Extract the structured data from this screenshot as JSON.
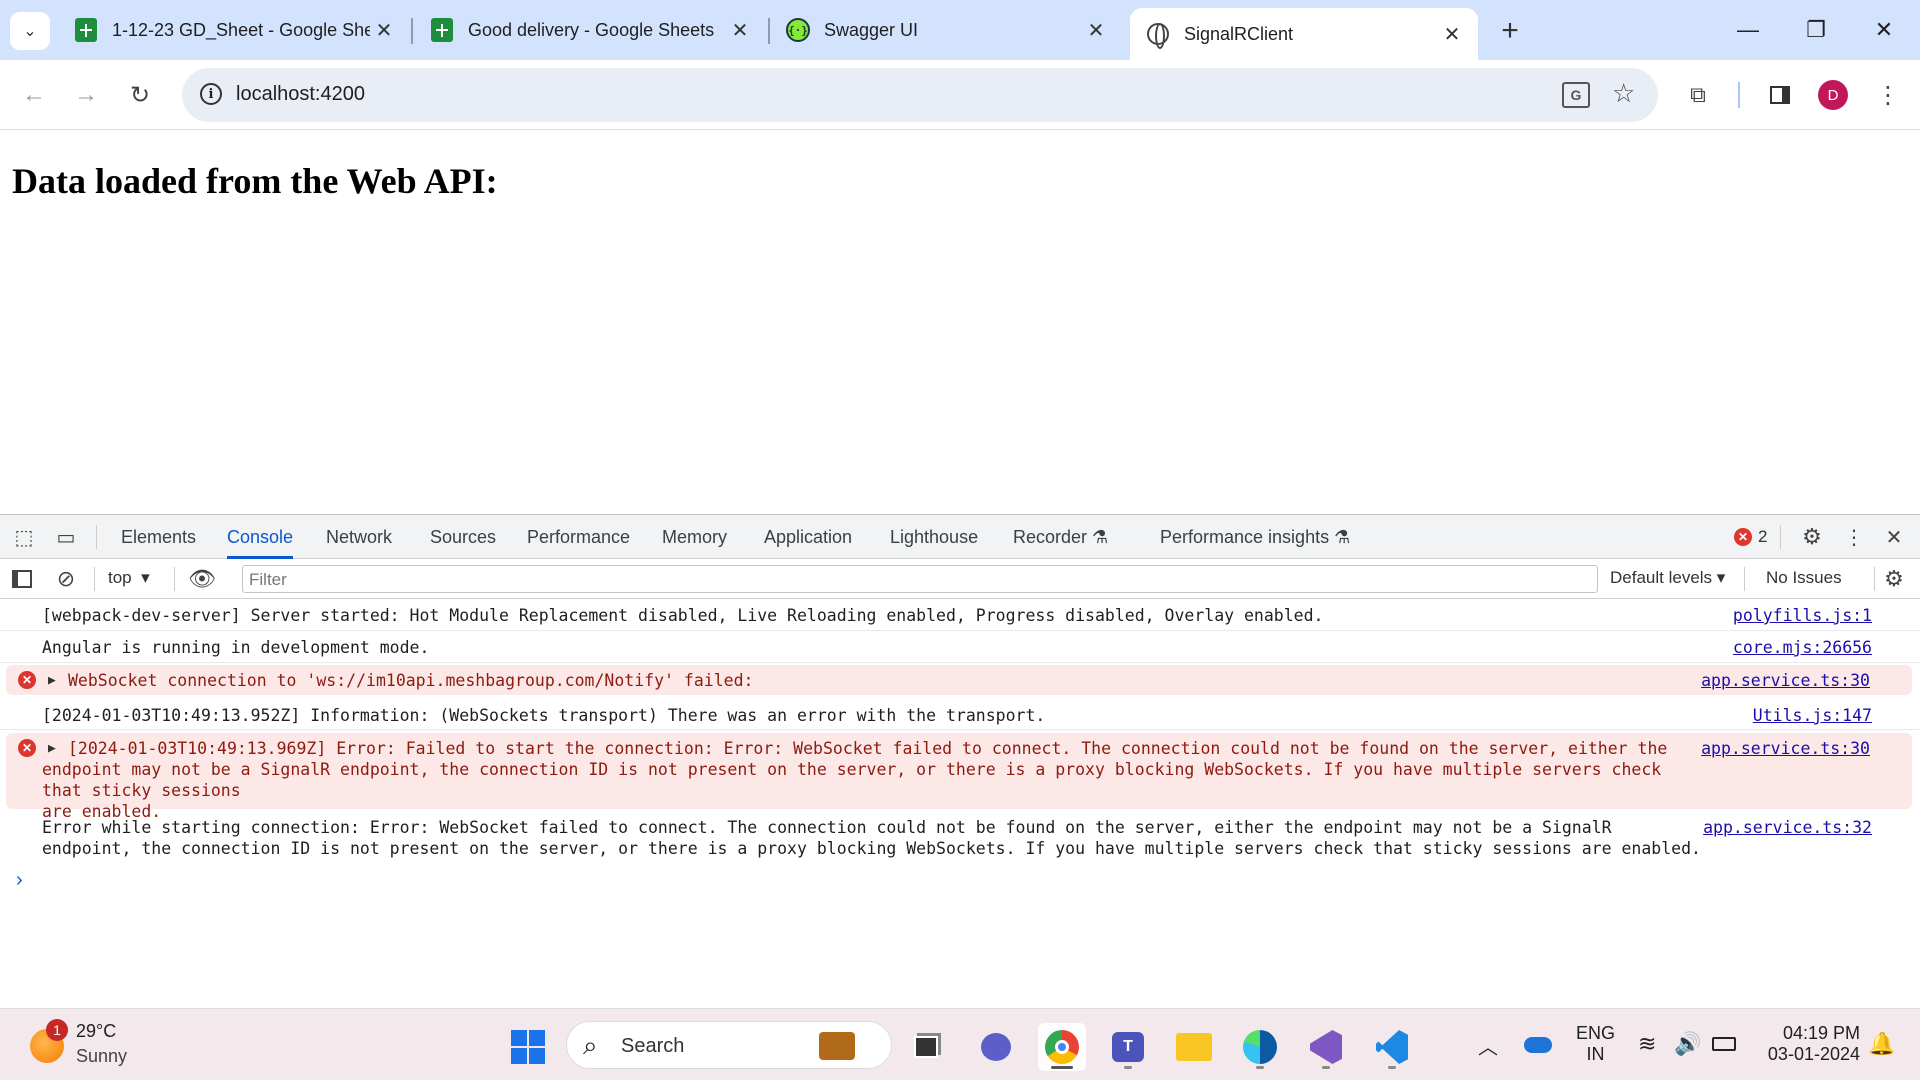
{
  "browser": {
    "tabs": [
      {
        "title": "1-12-23 GD_Sheet - Google She",
        "icon": "google-sheets-icon"
      },
      {
        "title": "Good delivery - Google Sheets",
        "icon": "google-sheets-icon"
      },
      {
        "title": "Swagger UI",
        "icon": "swagger-icon"
      },
      {
        "title": "SignalRClient",
        "icon": "globe-icon",
        "active": true
      }
    ],
    "new_tab": "+",
    "url": "localhost:4200",
    "profile_initial": "D"
  },
  "page": {
    "heading": "Data loaded from the Web API:"
  },
  "devtools": {
    "tabs": [
      "Elements",
      "Console",
      "Network",
      "Sources",
      "Performance",
      "Memory",
      "Application",
      "Lighthouse",
      "Recorder",
      "Performance insights"
    ],
    "active_tab": "Console",
    "error_count": "2",
    "context": "top",
    "filter_placeholder": "Filter",
    "levels": "Default levels",
    "issues": "No Issues",
    "logs": [
      {
        "type": "log",
        "text": "[webpack-dev-server] Server started: Hot Module Replacement disabled, Live Reloading enabled, Progress disabled, Overlay enabled.",
        "source": "polyfills.js:1"
      },
      {
        "type": "log",
        "text": "Angular is running in development mode.",
        "source": "core.mjs:26656"
      },
      {
        "type": "error",
        "text": "WebSocket connection to 'ws://im10api.meshbagroup.com/Notify' failed:",
        "source": "app.service.ts:30"
      },
      {
        "type": "log",
        "text": "[2024-01-03T10:49:13.952Z] Information: (WebSockets transport) There was an error with the transport.",
        "source": "Utils.js:147"
      },
      {
        "type": "error",
        "text": "[2024-01-03T10:49:13.969Z] Error: Failed to start the connection: Error: WebSocket failed to connect. The connection could not be found on the server, either the\nendpoint may not be a SignalR endpoint, the connection ID is not present on the server, or there is a proxy blocking WebSockets. If you have multiple servers check that sticky sessions\nare enabled.",
        "source": "app.service.ts:30"
      },
      {
        "type": "log",
        "text": "Error while starting connection: Error: WebSocket failed to connect. The connection could not be found on the server, either the endpoint may not be a SignalR\nendpoint, the connection ID is not present on the server, or there is a proxy blocking WebSockets. If you have multiple servers check that sticky sessions are enabled.",
        "source": "app.service.ts:32"
      }
    ],
    "prompt": "›"
  },
  "taskbar": {
    "weather_temp": "29°C",
    "weather_desc": "Sunny",
    "weather_badge": "1",
    "search_label": "Search",
    "lang": "ENG",
    "region": "IN",
    "time": "04:19 PM",
    "date": "03-01-2024"
  },
  "colors": {
    "tabstrip": "#d3e3fd",
    "accent": "#0b57d0",
    "error_bg": "#fce8e6",
    "error_text": "#8e1a10",
    "taskbar": "#f3e9ec"
  }
}
